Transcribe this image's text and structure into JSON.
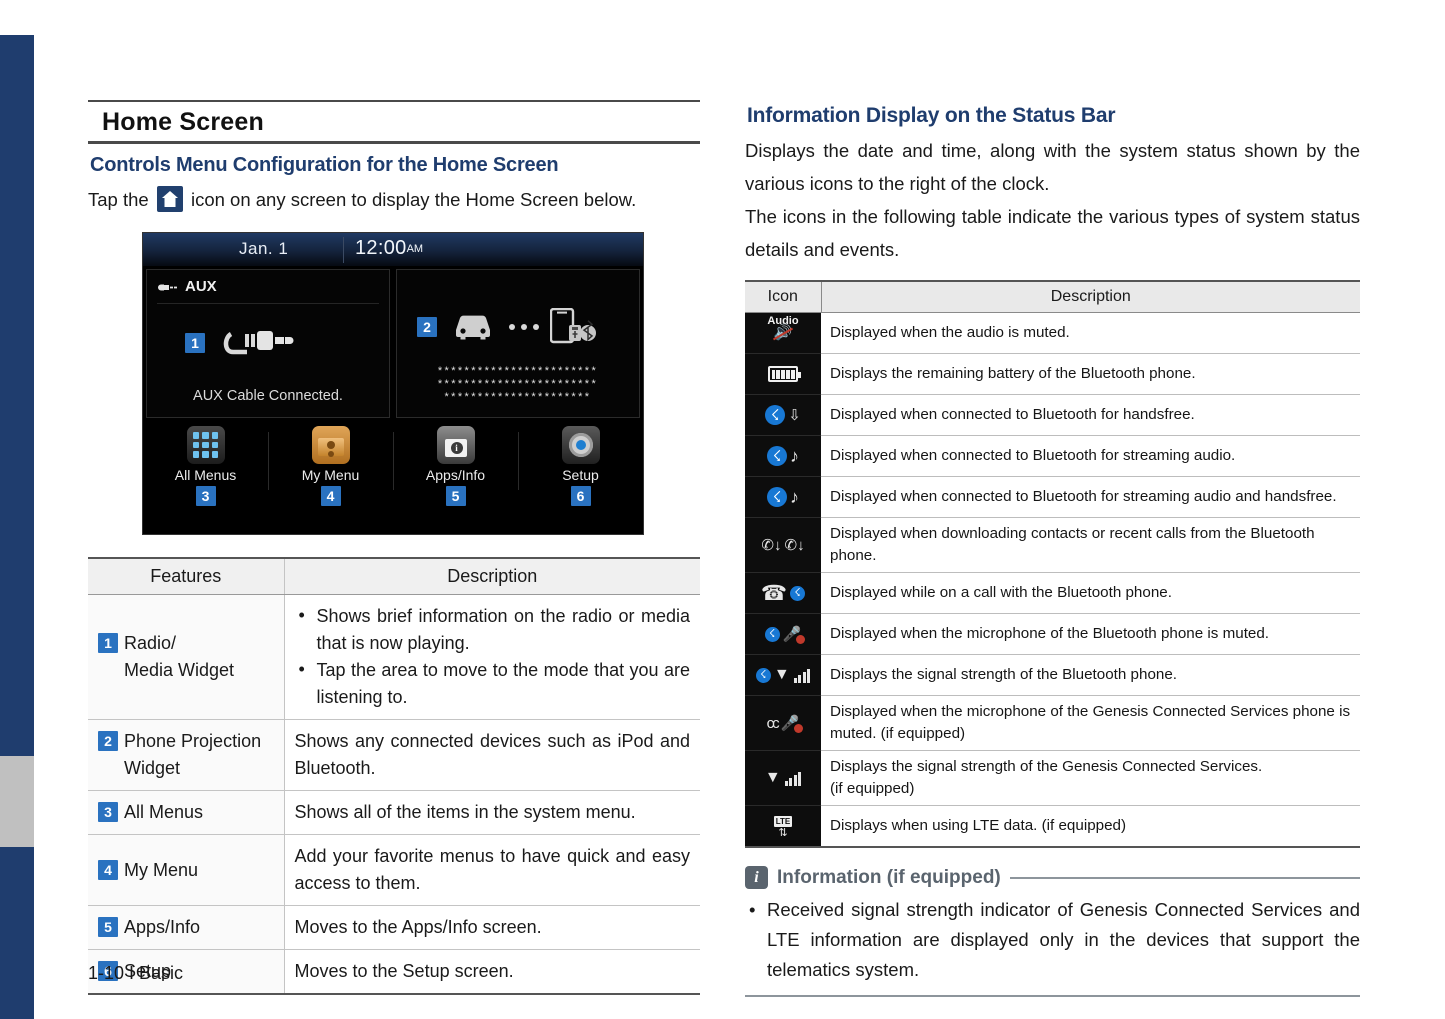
{
  "page": {
    "footer": "1-10 I Basic"
  },
  "left": {
    "chapter_title": "Home Screen",
    "section_heading": "Controls Menu Configuration for the Home Screen",
    "intro_before_icon": "Tap the",
    "home_icon_name": "home-icon",
    "intro_after_icon": "icon on any screen to display the Home Screen below.",
    "head_unit": {
      "date": "Jan.  1",
      "time": "12:00",
      "ampm": "AM",
      "aux_widget": {
        "title": "AUX",
        "badge": "1",
        "caption": "AUX Cable Connected."
      },
      "phone_widget": {
        "badge": "2",
        "stars_line1": "************************",
        "stars_line2": "************************",
        "stars_line3": "**********************"
      },
      "tiles": [
        {
          "label": "All Menus",
          "badge": "3",
          "icon": "grid-icon"
        },
        {
          "label": "My Menu",
          "badge": "4",
          "icon": "folder-person-icon"
        },
        {
          "label": "Apps/Info",
          "badge": "5",
          "icon": "apps-info-icon"
        },
        {
          "label": "Setup",
          "badge": "6",
          "icon": "gear-icon"
        }
      ]
    },
    "table": {
      "headers": [
        "Features",
        "Description"
      ],
      "rows": [
        {
          "badge": "1",
          "feature_line1": "Radio/",
          "feature_line2": "Media Widget",
          "bullets": [
            "Shows brief information on the radio or media that is now playing.",
            "Tap the area to move to the mode that you are listening to."
          ]
        },
        {
          "badge": "2",
          "feature_line1": "Phone Projection",
          "feature_line2": "Widget",
          "description": "Shows any connected devices such as iPod and Bluetooth."
        },
        {
          "badge": "3",
          "feature_line1": "All Menus",
          "feature_line2": "",
          "description": "Shows all of the items in the system menu."
        },
        {
          "badge": "4",
          "feature_line1": "My Menu",
          "feature_line2": "",
          "description": "Add your favorite menus to have quick and easy access to them."
        },
        {
          "badge": "5",
          "feature_line1": "Apps/Info",
          "feature_line2": "",
          "description": "Moves to the Apps/Info screen."
        },
        {
          "badge": "6",
          "feature_line1": "Setup",
          "feature_line2": "",
          "description": "Moves to the Setup screen."
        }
      ]
    }
  },
  "right": {
    "heading": "Information Display on the Status Bar",
    "para1": "Displays the date and time, along with the system status shown by the various icons to the right of the clock.",
    "para2": "The icons in the following table indicate the various types of system status details and events.",
    "table": {
      "headers": [
        "Icon",
        "Description"
      ],
      "rows": [
        {
          "icon": "audio-mute-icon",
          "description": "Displayed when the audio is muted."
        },
        {
          "icon": "battery-icon",
          "description": "Displays the remaining battery of the Bluetooth phone."
        },
        {
          "icon": "bluetooth-handsfree-icon",
          "description": "Displayed when connected to Bluetooth for handsfree."
        },
        {
          "icon": "bluetooth-audio-icon",
          "description": "Displayed when connected to Bluetooth for streaming audio."
        },
        {
          "icon": "bluetooth-audio-handsfree-icon",
          "description": "Displayed when connected to Bluetooth for streaming audio and handsfree."
        },
        {
          "icon": "contacts-download-icon",
          "description": "Displayed when downloading contacts or recent calls from the Bluetooth phone."
        },
        {
          "icon": "bluetooth-call-icon",
          "description": "Displayed while on a call with the Bluetooth phone."
        },
        {
          "icon": "bluetooth-mic-mute-icon",
          "description": "Displayed when the microphone of the Bluetooth phone is muted."
        },
        {
          "icon": "bluetooth-signal-icon",
          "description": "Displays the signal strength of the Bluetooth phone."
        },
        {
          "icon": "gcs-mic-mute-icon",
          "description": "Displayed when the microphone of the Genesis Connected Services phone is muted. (if equipped)"
        },
        {
          "icon": "gcs-signal-icon",
          "description": "Displays the signal strength of the Genesis Connected Services.\n(if equipped)"
        },
        {
          "icon": "lte-data-icon",
          "description": "Displays when using LTE data. (if equipped)"
        }
      ]
    },
    "info": {
      "icon": "info-icon",
      "title": "Information (if equipped)",
      "bullets": [
        "Received signal strength indicator of Genesis Connected Services and LTE information are displayed only in the devices that support the telematics system."
      ]
    }
  },
  "colors": {
    "heading_blue": "#1f3d6e",
    "badge_blue": "#2a72c0",
    "edge_tab_blue": "#1f3d6e",
    "edge_tab_active": "#c0c0c0",
    "info_gray": "#5a646e",
    "bluetooth_blue": "#1878d4",
    "mute_red": "#c0392b"
  }
}
